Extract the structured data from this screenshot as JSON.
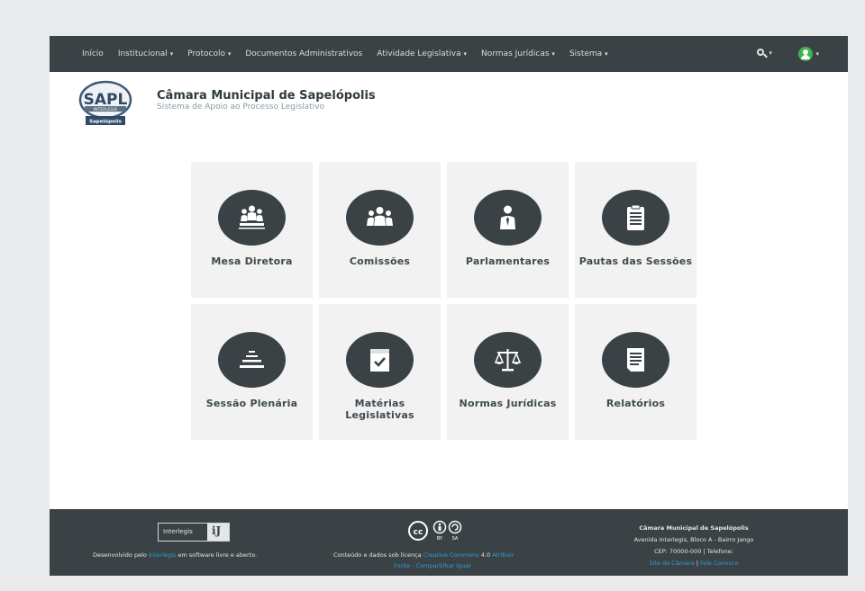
{
  "nav": {
    "items": [
      {
        "label": "Início",
        "caret": ""
      },
      {
        "label": "Institucional",
        "caret": "▾"
      },
      {
        "label": "Protocolo",
        "caret": "▾"
      },
      {
        "label": "Documentos Administrativos",
        "caret": ""
      },
      {
        "label": "Atividade Legislativa",
        "caret": "▾"
      },
      {
        "label": "Normas Jurídicas",
        "caret": "▾"
      },
      {
        "label": "Sistema",
        "caret": "▾"
      }
    ],
    "search_caret": "▾",
    "user_caret": "▾",
    "user_icon_color": "#3fb44a"
  },
  "header": {
    "logo_text": "SAPL",
    "logo_band": "INTERLEGIS",
    "logo_city": "Sapelópolis",
    "institution_name": "Câmara Municipal de Sapelópolis",
    "system_name": "Sistema de Apoio ao Processo Legislativo"
  },
  "tiles": [
    {
      "label": "Mesa Diretora",
      "icon": "board-icon"
    },
    {
      "label": "Comissões",
      "icon": "group-icon"
    },
    {
      "label": "Parlamentares",
      "icon": "person-icon"
    },
    {
      "label": "Pautas das Sessões",
      "icon": "clipboard-icon"
    },
    {
      "label": "Sessão Plenária",
      "icon": "plenary-icon"
    },
    {
      "label": "Matérias Legislativas",
      "icon": "checked-document-icon"
    },
    {
      "label": "Normas Jurídicas",
      "icon": "scales-icon"
    },
    {
      "label": "Relatórios",
      "icon": "report-icon"
    }
  ],
  "footer": {
    "interlegis_logo_text": "Interlegis",
    "interlegis_logo_mark": "iJ",
    "developed_prefix": "Desenvolvido pelo ",
    "developed_link": "Interlegis",
    "developed_suffix": " em software livre e aberto.",
    "license_prefix": "Conteúdo e dados sob licença ",
    "license_link": "Creative Commons",
    "license_version": " 4.0 ",
    "license_attrib": "Atribuir",
    "license_line2": "Fonte - Compartilhar Igual",
    "cc_by": "BY",
    "cc_sa": "SA",
    "address_title": "Câmara Municipal de Sapelópolis",
    "address_line": "Avenida Interlegis, Bloco A - Bairro Jango",
    "cep_line": "CEP: 70000-000 | Telefone:",
    "site_link": "Site da Câmara",
    "separator": " | ",
    "contact_link": "Fale Conosco"
  },
  "colors": {
    "navbar": "#3a4245",
    "tile_bg": "#f2f2f2",
    "icon_circle": "#3a4245",
    "link": "#2b9ed9"
  }
}
